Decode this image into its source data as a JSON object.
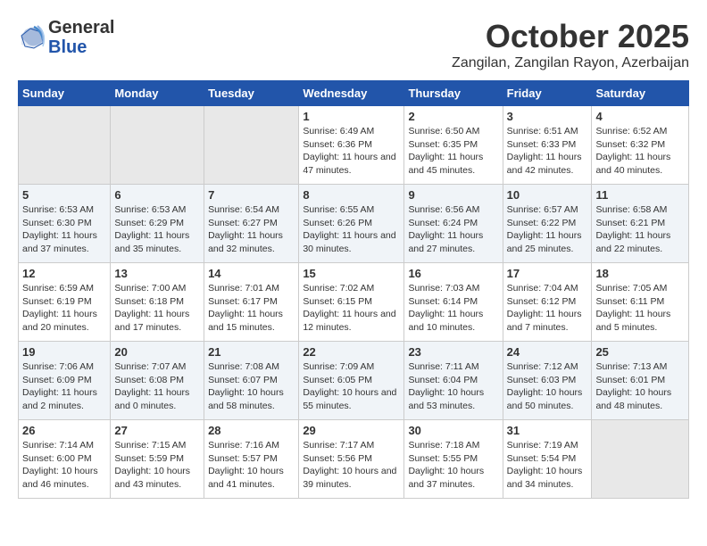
{
  "header": {
    "logo_general": "General",
    "logo_blue": "Blue",
    "title": "October 2025",
    "location": "Zangilan, Zangilan Rayon, Azerbaijan"
  },
  "days_of_week": [
    "Sunday",
    "Monday",
    "Tuesday",
    "Wednesday",
    "Thursday",
    "Friday",
    "Saturday"
  ],
  "weeks": [
    [
      {
        "day": "",
        "empty": true
      },
      {
        "day": "",
        "empty": true
      },
      {
        "day": "",
        "empty": true
      },
      {
        "day": "1",
        "sunrise": "6:49 AM",
        "sunset": "6:36 PM",
        "daylight": "11 hours and 47 minutes."
      },
      {
        "day": "2",
        "sunrise": "6:50 AM",
        "sunset": "6:35 PM",
        "daylight": "11 hours and 45 minutes."
      },
      {
        "day": "3",
        "sunrise": "6:51 AM",
        "sunset": "6:33 PM",
        "daylight": "11 hours and 42 minutes."
      },
      {
        "day": "4",
        "sunrise": "6:52 AM",
        "sunset": "6:32 PM",
        "daylight": "11 hours and 40 minutes."
      }
    ],
    [
      {
        "day": "5",
        "sunrise": "6:53 AM",
        "sunset": "6:30 PM",
        "daylight": "11 hours and 37 minutes."
      },
      {
        "day": "6",
        "sunrise": "6:53 AM",
        "sunset": "6:29 PM",
        "daylight": "11 hours and 35 minutes."
      },
      {
        "day": "7",
        "sunrise": "6:54 AM",
        "sunset": "6:27 PM",
        "daylight": "11 hours and 32 minutes."
      },
      {
        "day": "8",
        "sunrise": "6:55 AM",
        "sunset": "6:26 PM",
        "daylight": "11 hours and 30 minutes."
      },
      {
        "day": "9",
        "sunrise": "6:56 AM",
        "sunset": "6:24 PM",
        "daylight": "11 hours and 27 minutes."
      },
      {
        "day": "10",
        "sunrise": "6:57 AM",
        "sunset": "6:22 PM",
        "daylight": "11 hours and 25 minutes."
      },
      {
        "day": "11",
        "sunrise": "6:58 AM",
        "sunset": "6:21 PM",
        "daylight": "11 hours and 22 minutes."
      }
    ],
    [
      {
        "day": "12",
        "sunrise": "6:59 AM",
        "sunset": "6:19 PM",
        "daylight": "11 hours and 20 minutes."
      },
      {
        "day": "13",
        "sunrise": "7:00 AM",
        "sunset": "6:18 PM",
        "daylight": "11 hours and 17 minutes."
      },
      {
        "day": "14",
        "sunrise": "7:01 AM",
        "sunset": "6:17 PM",
        "daylight": "11 hours and 15 minutes."
      },
      {
        "day": "15",
        "sunrise": "7:02 AM",
        "sunset": "6:15 PM",
        "daylight": "11 hours and 12 minutes."
      },
      {
        "day": "16",
        "sunrise": "7:03 AM",
        "sunset": "6:14 PM",
        "daylight": "11 hours and 10 minutes."
      },
      {
        "day": "17",
        "sunrise": "7:04 AM",
        "sunset": "6:12 PM",
        "daylight": "11 hours and 7 minutes."
      },
      {
        "day": "18",
        "sunrise": "7:05 AM",
        "sunset": "6:11 PM",
        "daylight": "11 hours and 5 minutes."
      }
    ],
    [
      {
        "day": "19",
        "sunrise": "7:06 AM",
        "sunset": "6:09 PM",
        "daylight": "11 hours and 2 minutes."
      },
      {
        "day": "20",
        "sunrise": "7:07 AM",
        "sunset": "6:08 PM",
        "daylight": "11 hours and 0 minutes."
      },
      {
        "day": "21",
        "sunrise": "7:08 AM",
        "sunset": "6:07 PM",
        "daylight": "10 hours and 58 minutes."
      },
      {
        "day": "22",
        "sunrise": "7:09 AM",
        "sunset": "6:05 PM",
        "daylight": "10 hours and 55 minutes."
      },
      {
        "day": "23",
        "sunrise": "7:11 AM",
        "sunset": "6:04 PM",
        "daylight": "10 hours and 53 minutes."
      },
      {
        "day": "24",
        "sunrise": "7:12 AM",
        "sunset": "6:03 PM",
        "daylight": "10 hours and 50 minutes."
      },
      {
        "day": "25",
        "sunrise": "7:13 AM",
        "sunset": "6:01 PM",
        "daylight": "10 hours and 48 minutes."
      }
    ],
    [
      {
        "day": "26",
        "sunrise": "7:14 AM",
        "sunset": "6:00 PM",
        "daylight": "10 hours and 46 minutes."
      },
      {
        "day": "27",
        "sunrise": "7:15 AM",
        "sunset": "5:59 PM",
        "daylight": "10 hours and 43 minutes."
      },
      {
        "day": "28",
        "sunrise": "7:16 AM",
        "sunset": "5:57 PM",
        "daylight": "10 hours and 41 minutes."
      },
      {
        "day": "29",
        "sunrise": "7:17 AM",
        "sunset": "5:56 PM",
        "daylight": "10 hours and 39 minutes."
      },
      {
        "day": "30",
        "sunrise": "7:18 AM",
        "sunset": "5:55 PM",
        "daylight": "10 hours and 37 minutes."
      },
      {
        "day": "31",
        "sunrise": "7:19 AM",
        "sunset": "5:54 PM",
        "daylight": "10 hours and 34 minutes."
      },
      {
        "day": "",
        "empty": true
      }
    ]
  ]
}
